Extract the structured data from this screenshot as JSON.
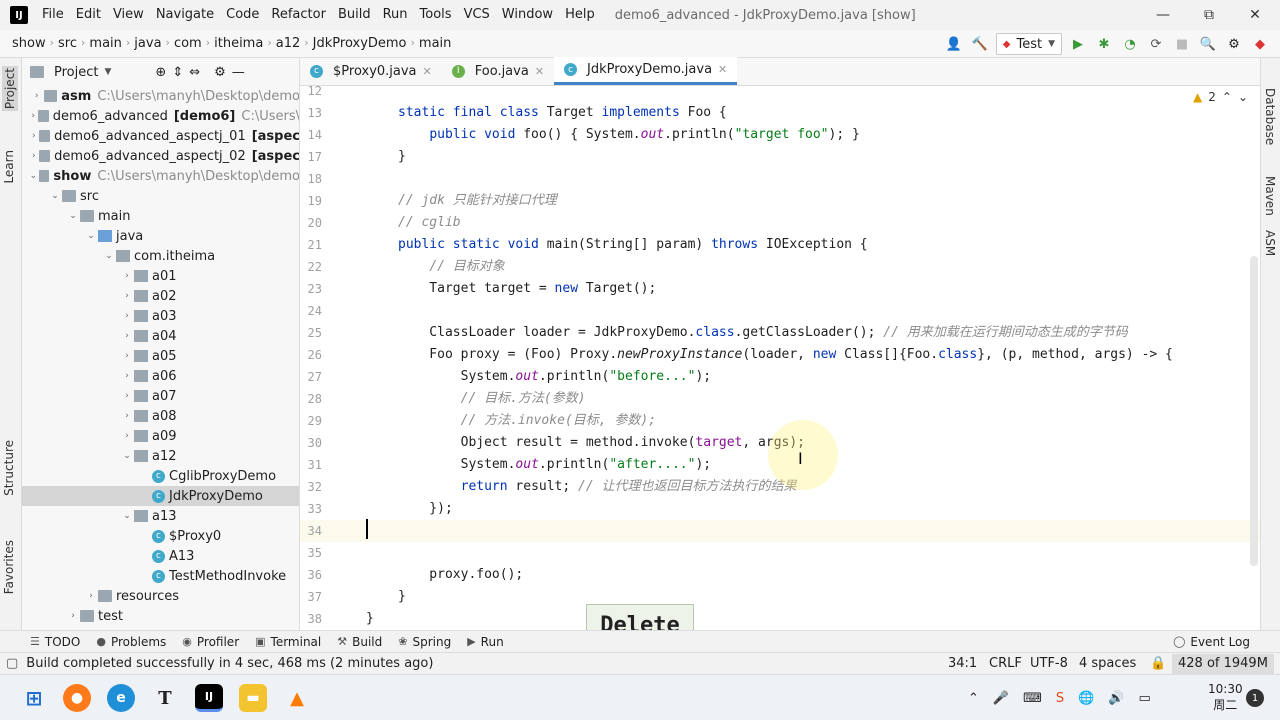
{
  "menubar": {
    "logo": "IJ",
    "items": [
      "File",
      "Edit",
      "View",
      "Navigate",
      "Code",
      "Refactor",
      "Build",
      "Run",
      "Tools",
      "VCS",
      "Window",
      "Help"
    ],
    "title": "demo6_advanced - JdkProxyDemo.java [show]"
  },
  "window_controls": {
    "minimize": "—",
    "maximize": "⧉",
    "close": "✕"
  },
  "breadcrumbs": [
    "show",
    "src",
    "main",
    "java",
    "com",
    "itheima",
    "a12",
    "JdkProxyDemo",
    "main"
  ],
  "toolbar": {
    "run_config": "Test",
    "run_config_arrow": "▼"
  },
  "left_strip": {
    "project": "Project",
    "learn": "Learn",
    "structure": "Structure",
    "favorites": "Favorites"
  },
  "project_panel": {
    "header": "Project",
    "rows": [
      {
        "indent": 0,
        "arrow": "›",
        "icon": "folder",
        "name": "asm",
        "bold": true,
        "path": "C:\\Users\\manyh\\Desktop\\demo"
      },
      {
        "indent": 0,
        "arrow": "›",
        "icon": "folder",
        "name": "demo6_advanced",
        "bold": false,
        "extra": "[demo6]",
        "path": "C:\\Users\\"
      },
      {
        "indent": 0,
        "arrow": "›",
        "icon": "folder",
        "name": "demo6_advanced_aspectj_01",
        "bold": false,
        "extra": "[aspec"
      },
      {
        "indent": 0,
        "arrow": "›",
        "icon": "folder",
        "name": "demo6_advanced_aspectj_02",
        "bold": false,
        "extra": "[aspec"
      },
      {
        "indent": 0,
        "arrow": "⌄",
        "icon": "folder",
        "name": "show",
        "bold": true,
        "path": "C:\\Users\\manyh\\Desktop\\demo"
      },
      {
        "indent": 1,
        "arrow": "⌄",
        "icon": "folder",
        "name": "src"
      },
      {
        "indent": 2,
        "arrow": "⌄",
        "icon": "folder",
        "name": "main"
      },
      {
        "indent": 3,
        "arrow": "⌄",
        "icon": "src",
        "name": "java"
      },
      {
        "indent": 4,
        "arrow": "⌄",
        "icon": "pkg",
        "name": "com.itheima"
      },
      {
        "indent": 5,
        "arrow": "›",
        "icon": "pkg",
        "name": "a01"
      },
      {
        "indent": 5,
        "arrow": "›",
        "icon": "pkg",
        "name": "a02"
      },
      {
        "indent": 5,
        "arrow": "›",
        "icon": "pkg",
        "name": "a03"
      },
      {
        "indent": 5,
        "arrow": "›",
        "icon": "pkg",
        "name": "a04"
      },
      {
        "indent": 5,
        "arrow": "›",
        "icon": "pkg",
        "name": "a05"
      },
      {
        "indent": 5,
        "arrow": "›",
        "icon": "pkg",
        "name": "a06"
      },
      {
        "indent": 5,
        "arrow": "›",
        "icon": "pkg",
        "name": "a07"
      },
      {
        "indent": 5,
        "arrow": "›",
        "icon": "pkg",
        "name": "a08"
      },
      {
        "indent": 5,
        "arrow": "›",
        "icon": "pkg",
        "name": "a09"
      },
      {
        "indent": 5,
        "arrow": "⌄",
        "icon": "pkg",
        "name": "a12"
      },
      {
        "indent": 6,
        "arrow": "",
        "icon": "cls",
        "name": "CglibProxyDemo"
      },
      {
        "indent": 6,
        "arrow": "",
        "icon": "cls",
        "name": "JdkProxyDemo",
        "selected": true
      },
      {
        "indent": 5,
        "arrow": "⌄",
        "icon": "pkg",
        "name": "a13"
      },
      {
        "indent": 6,
        "arrow": "",
        "icon": "cls",
        "name": "$Proxy0"
      },
      {
        "indent": 6,
        "arrow": "",
        "icon": "cls",
        "name": "A13"
      },
      {
        "indent": 6,
        "arrow": "",
        "icon": "cls",
        "name": "TestMethodInvoke"
      },
      {
        "indent": 3,
        "arrow": "›",
        "icon": "folder",
        "name": "resources"
      },
      {
        "indent": 2,
        "arrow": "›",
        "icon": "folder",
        "name": "test"
      }
    ]
  },
  "tabs": [
    {
      "label": "$Proxy0.java",
      "active": false
    },
    {
      "label": "Foo.java",
      "active": false
    },
    {
      "label": "JdkProxyDemo.java",
      "active": true
    }
  ],
  "right_strip": {
    "database": "Database",
    "maven": "Maven",
    "asm": "ASM"
  },
  "inspection": {
    "count": "2"
  },
  "editor": {
    "lines": [
      {
        "n": "12",
        "html": ""
      },
      {
        "n": "13",
        "html": "<span class='kw'>static final class</span> Target <span class='kw'>implements</span> Foo {"
      },
      {
        "n": "14",
        "html": "    <span class='kw'>public void</span> foo() { System.<span class='fld'>out</span>.println(<span class='str'>\"target foo\"</span>); }"
      },
      {
        "n": "17",
        "html": "}"
      },
      {
        "n": "18",
        "html": ""
      },
      {
        "n": "19",
        "html": "<span class='cm'>// jdk 只能针对接口代理</span>"
      },
      {
        "n": "20",
        "html": "<span class='cm'>// cglib</span>"
      },
      {
        "n": "21",
        "html": "<span class='kw'>public static void</span> main(String[] param) <span class='kw'>throws</span> IOException {"
      },
      {
        "n": "22",
        "html": "    <span class='cm'>// 目标对象</span>"
      },
      {
        "n": "23",
        "html": "    Target target = <span class='kw'>new</span> Target();"
      },
      {
        "n": "24",
        "html": ""
      },
      {
        "n": "25",
        "html": "    ClassLoader loader = JdkProxyDemo.<span class='kw'>class</span>.getClassLoader(); <span class='cm'>// 用来加载在运行期间动态生成的字节码</span>"
      },
      {
        "n": "26",
        "html": "    Foo proxy = (Foo) Proxy.<span class='it'>newProxyInstance</span>(loader, <span class='kw'>new</span> Class[]{Foo.<span class='kw'>class</span>}, (p, method, args) -> {"
      },
      {
        "n": "27",
        "html": "        System.<span class='fld'>out</span>.println(<span class='str'>\"before...\"</span>);"
      },
      {
        "n": "28",
        "html": "        <span class='cm'>// 目标.方法(参数)</span>"
      },
      {
        "n": "29",
        "html": "        <span class='cm'>// 方法.invoke(目标, 参数);</span>"
      },
      {
        "n": "30",
        "html": "        Object result = method.invoke(<span class='prm'>target</span>, args);"
      },
      {
        "n": "31",
        "html": "        System.<span class='fld'>out</span>.println(<span class='str'>\"after....\"</span>);"
      },
      {
        "n": "32",
        "html": "        <span class='kw'>return</span> result; <span class='cm'>// 让代理也返回目标方法执行的结果</span>"
      },
      {
        "n": "33",
        "html": "    });"
      },
      {
        "n": "34",
        "html": "",
        "current": true
      },
      {
        "n": "35",
        "html": ""
      },
      {
        "n": "36",
        "html": "    proxy.foo();"
      },
      {
        "n": "37",
        "html": "}"
      },
      {
        "n": "38",
        "html": "}<span style='margin-left:-98px'></span>"
      }
    ]
  },
  "toast": {
    "text": "Delete"
  },
  "bottom_tools": [
    "TODO",
    "Problems",
    "Profiler",
    "Terminal",
    "Build",
    "Spring",
    "Run"
  ],
  "event_log": "Event Log",
  "status": {
    "message": "Build completed successfully in 4 sec, 468 ms (2 minutes ago)",
    "position": "34:1",
    "line_sep": "CRLF",
    "encoding": "UTF-8",
    "indent": "4 spaces",
    "memory": "428 of 1949M"
  },
  "taskbar": {
    "time": "10:30",
    "day": "周二"
  }
}
